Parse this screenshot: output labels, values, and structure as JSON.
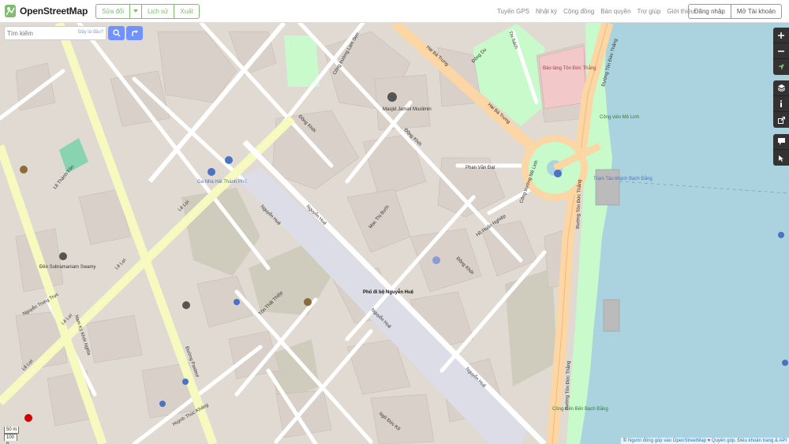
{
  "brand": {
    "name": "OpenStreetMap"
  },
  "edit_group": {
    "edit": "Sửa đổi",
    "history": "Lịch sử",
    "export": "Xuất"
  },
  "nav": [
    "Tuyến GPS",
    "Nhật ký",
    "Cộng đồng",
    "Bản quyền",
    "Trợ giúp",
    "Giới thiệu"
  ],
  "account": {
    "login": "Đăng nhập",
    "signup": "Mở Tài khoản"
  },
  "search": {
    "placeholder": "Tìm kiếm",
    "where": "Đây là đâu?"
  },
  "scale": {
    "metric": "50 m",
    "imperial": "100 ft"
  },
  "attribution": {
    "prefix": "© ",
    "contributors": "Người đóng góp vào OpenStreetMap",
    "heart": " ♥ ",
    "donate": "Quyên góp",
    "sep": ". ",
    "terms": "Điều khoản trang & API"
  },
  "controls": [
    "zoom-in-icon",
    "zoom-out-icon",
    "locate-icon",
    "layers-icon",
    "info-icon",
    "share-icon",
    "note-icon",
    "query-icon"
  ],
  "colors": {
    "accent": "#7ebc6f",
    "water": "#aad3df",
    "primary_road": "#fcd6a4",
    "secondary_road": "#f7fabf",
    "park": "#c8facc",
    "building": "#d9d0c9",
    "land": "#e0dad3",
    "pedestrian": "#dddde8"
  },
  "map_labels": {
    "streets": {
      "le_loi_1": "Lê Lợi",
      "le_loi_2": "Lê Lợi",
      "le_loi_3": "Lê Lợi",
      "le_loi_4": "Lê Lợi",
      "nguyen_hue_1": "Nguyễn Huệ",
      "nguyen_hue_2": "Nguyễn Huệ",
      "nguyen_hue_3": "Nguyễn Huệ",
      "nguyen_hue_4": "Nguyễn Huệ",
      "dong_khoi_1": "Đồng Khởi",
      "dong_khoi_2": "Đồng Khởi",
      "dong_khoi_3": "Đồng Khởi",
      "ton_duc_thang_1": "Đường Tôn Đức Thắng",
      "ton_duc_thang_2": "Đường Tôn Đức Thắng",
      "ton_duc_thang_3": "Đường Tôn Đức Thắng",
      "hai_ba_trung_1": "Hai Bà Trưng",
      "hai_ba_trung_2": "Hai Bà Trưng",
      "pasteur": "Đường Pasteur",
      "nam_ky_khoi_nghia": "Nam Kỳ Khởi Nghĩa",
      "ton_that_thiep": "Tôn Thất Thiệp",
      "huynh_thuc_khang": "Huỳnh Thúc Kháng",
      "phan_van_dat": "Phan Văn Đạt",
      "ho_huan_nghiep": "Hồ Huấn Nghiệp",
      "mac_thi_buoi": "Mạc Thị Bưởi",
      "ngo_duc_ke": "Ngô Đức Kế",
      "me_linh": "Công trường Mê Linh",
      "le_thanh_ton": "Lê Thánh Tôn",
      "thi_sach": "Thi Sách",
      "nguyen_trung_truc": "Nguyễn Trung Trực",
      "cong_truong_lam_son": "Công trường Lam Sơn",
      "dong_du": "Đông Du"
    },
    "places": {
      "opera": "Ga Nhà Hát Thành Phố",
      "walking_street": "Phố đi bộ Nguyễn Huệ",
      "mosque": "Masjid Jamiul Muslimin",
      "temple": "Đền Subramaniam Swamy",
      "ton_duc_thang_museum": "Bảo tàng Tôn Đức Thắng",
      "me_linh_park": "Công viên Mê Linh",
      "bach_dang_park": "Công viên Bến Bạch Đằng",
      "ferry": "Trạm Tàu khách Bạch Đằng"
    }
  }
}
